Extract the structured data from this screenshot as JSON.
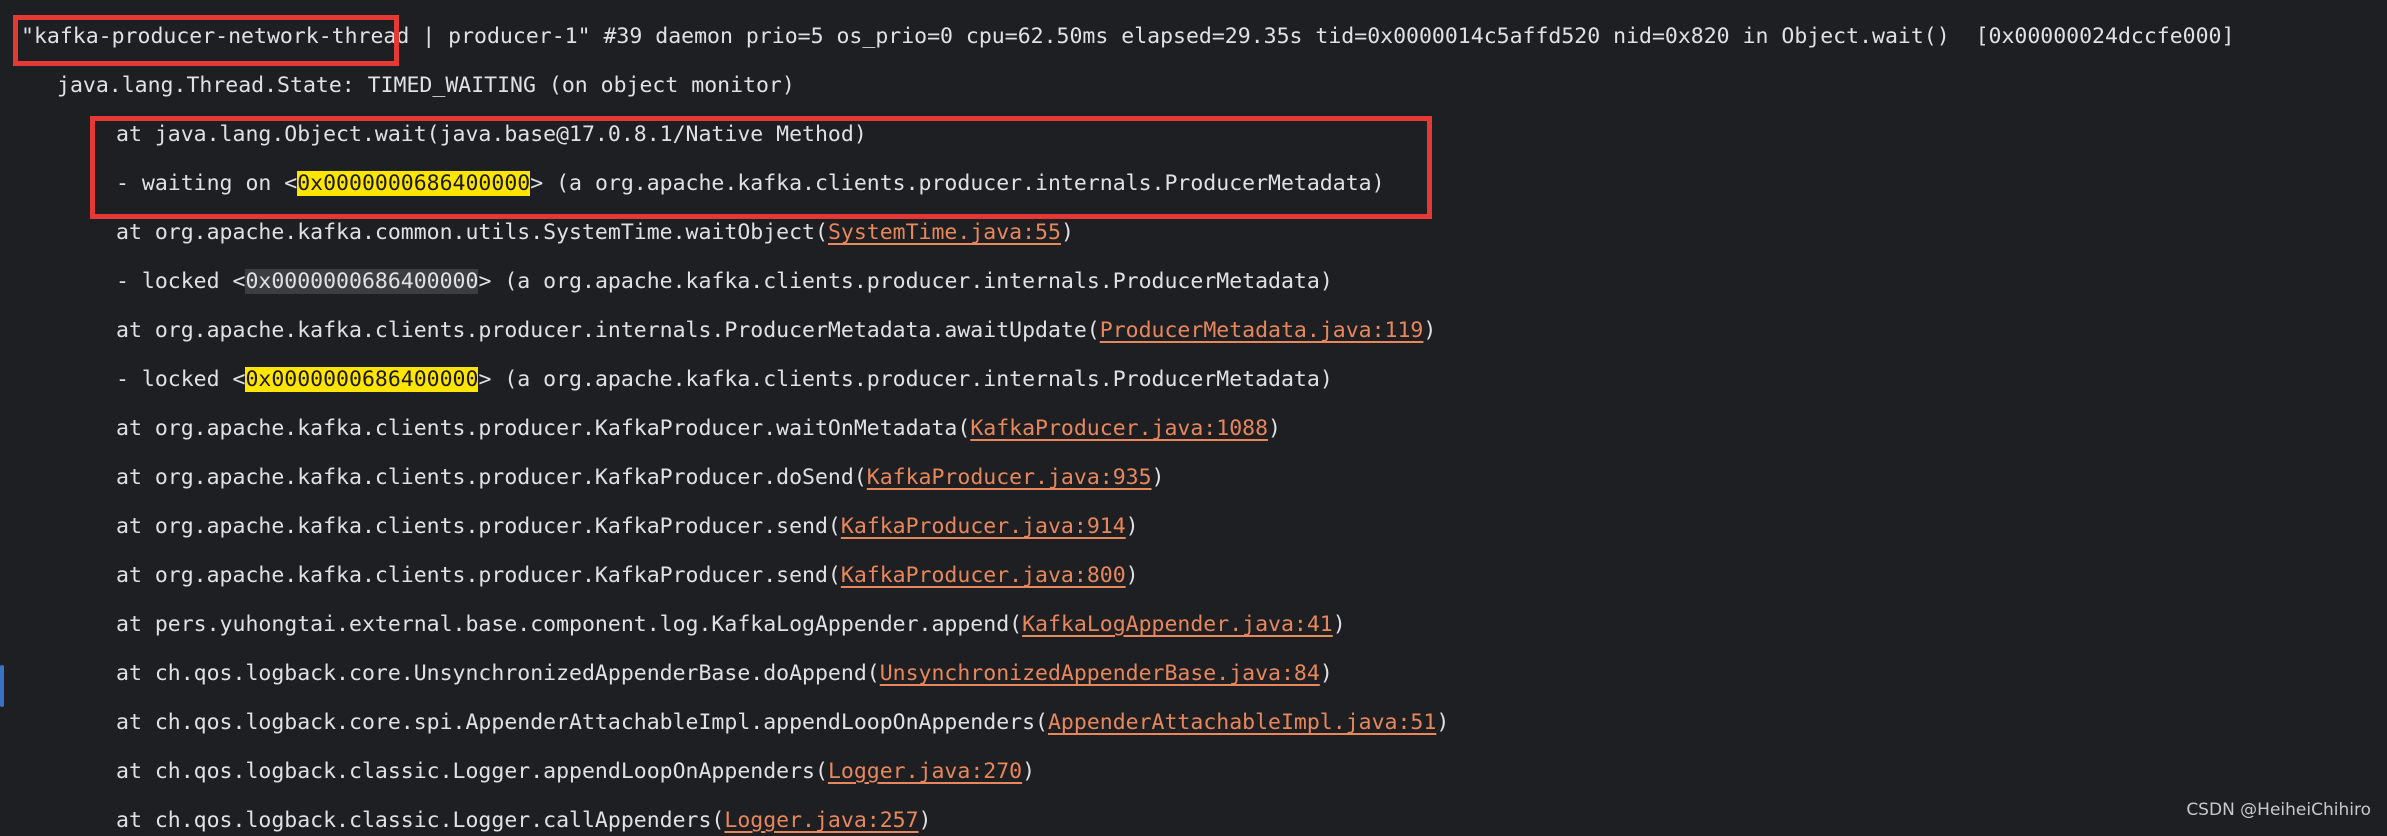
{
  "header": {
    "thread_name": "\"kafka-producer-network-thread",
    "rest": " | producer-1\" #39 daemon prio=5 os_prio=0 cpu=62.50ms elapsed=29.35s tid=0x0000014c5affd520 nid=0x820 in Object.wait()  [0x00000024dccfe000]"
  },
  "state_line": "java.lang.Thread.State: TIMED_WAITING (on object monitor)",
  "frames": [
    {
      "pre": "at java.lang.Object.wait(java.base@17.0.8.1/Native Method)",
      "link": "",
      "post": ""
    },
    {
      "pre": "- waiting on <",
      "hl": "0x0000000686400000",
      "post": "> (a org.apache.kafka.clients.producer.internals.ProducerMetadata)"
    },
    {
      "pre": "at org.apache.kafka.common.utils.SystemTime.waitObject(",
      "link": "SystemTime.java:55",
      "post": ")"
    },
    {
      "pre": "- locked <",
      "hl": "0x0000000686400000",
      "post": "> (a org.apache.kafka.clients.producer.internals.ProducerMetadata)"
    },
    {
      "pre": "at org.apache.kafka.clients.producer.internals.ProducerMetadata.awaitUpdate(",
      "link": "ProducerMetadata.java:119",
      "post": ")"
    },
    {
      "pre": "- locked <",
      "hl": "0x0000000686400000",
      "post": "> (a org.apache.kafka.clients.producer.internals.ProducerMetadata)"
    },
    {
      "pre": "at org.apache.kafka.clients.producer.KafkaProducer.waitOnMetadata(",
      "link": "KafkaProducer.java:1088",
      "post": ")"
    },
    {
      "pre": "at org.apache.kafka.clients.producer.KafkaProducer.doSend(",
      "link": "KafkaProducer.java:935",
      "post": ")"
    },
    {
      "pre": "at org.apache.kafka.clients.producer.KafkaProducer.send(",
      "link": "KafkaProducer.java:914",
      "post": ")"
    },
    {
      "pre": "at org.apache.kafka.clients.producer.KafkaProducer.send(",
      "link": "KafkaProducer.java:800",
      "post": ")"
    },
    {
      "pre": "at pers.yuhongtai.external.base.component.log.KafkaLogAppender.append(",
      "link": "KafkaLogAppender.java:41",
      "post": ")"
    },
    {
      "pre": "at ch.qos.logback.core.UnsynchronizedAppenderBase.doAppend(",
      "link": "UnsynchronizedAppenderBase.java:84",
      "post": ")"
    },
    {
      "pre": "at ch.qos.logback.core.spi.AppenderAttachableImpl.appendLoopOnAppenders(",
      "link": "AppenderAttachableImpl.java:51",
      "post": ")"
    },
    {
      "pre": "at ch.qos.logback.classic.Logger.appendLoopOnAppenders(",
      "link": "Logger.java:270",
      "post": ")"
    },
    {
      "pre": "at ch.qos.logback.classic.Logger.callAppenders(",
      "link": "Logger.java:257",
      "post": ")"
    }
  ],
  "watermark": "CSDN @HeiheiChihiro",
  "colors": {
    "annotation_box": "#e53935",
    "highlight": "#ffe500",
    "link": "#e8875c"
  }
}
